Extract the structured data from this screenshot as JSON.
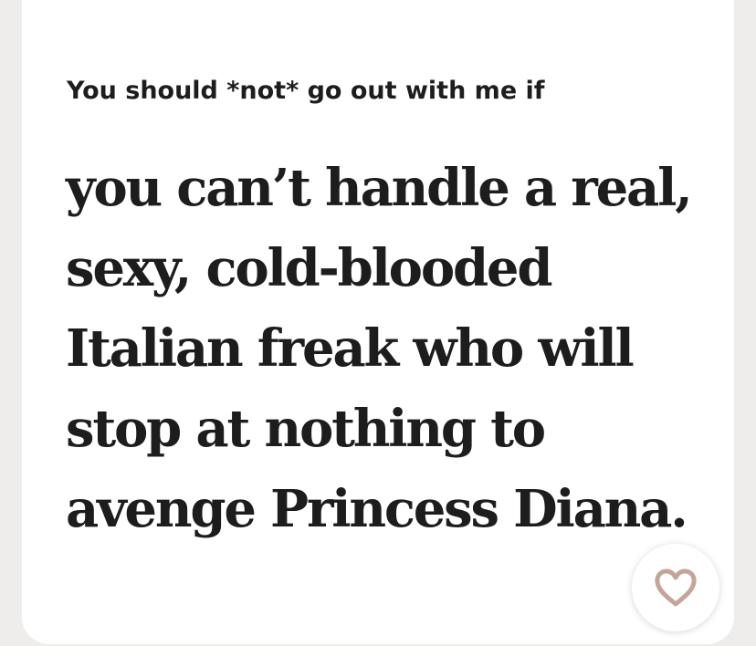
{
  "prompt_card": {
    "prompt": "You should *not* go out with me if",
    "answer_lines": [
      "you can’t handle a real,",
      "sexy, cold-blooded",
      "Italian freak who will",
      "stop at nothing to",
      "avenge Princess Diana."
    ],
    "like_icon": "heart-outline-icon",
    "accent_color": "#c5a59a"
  }
}
